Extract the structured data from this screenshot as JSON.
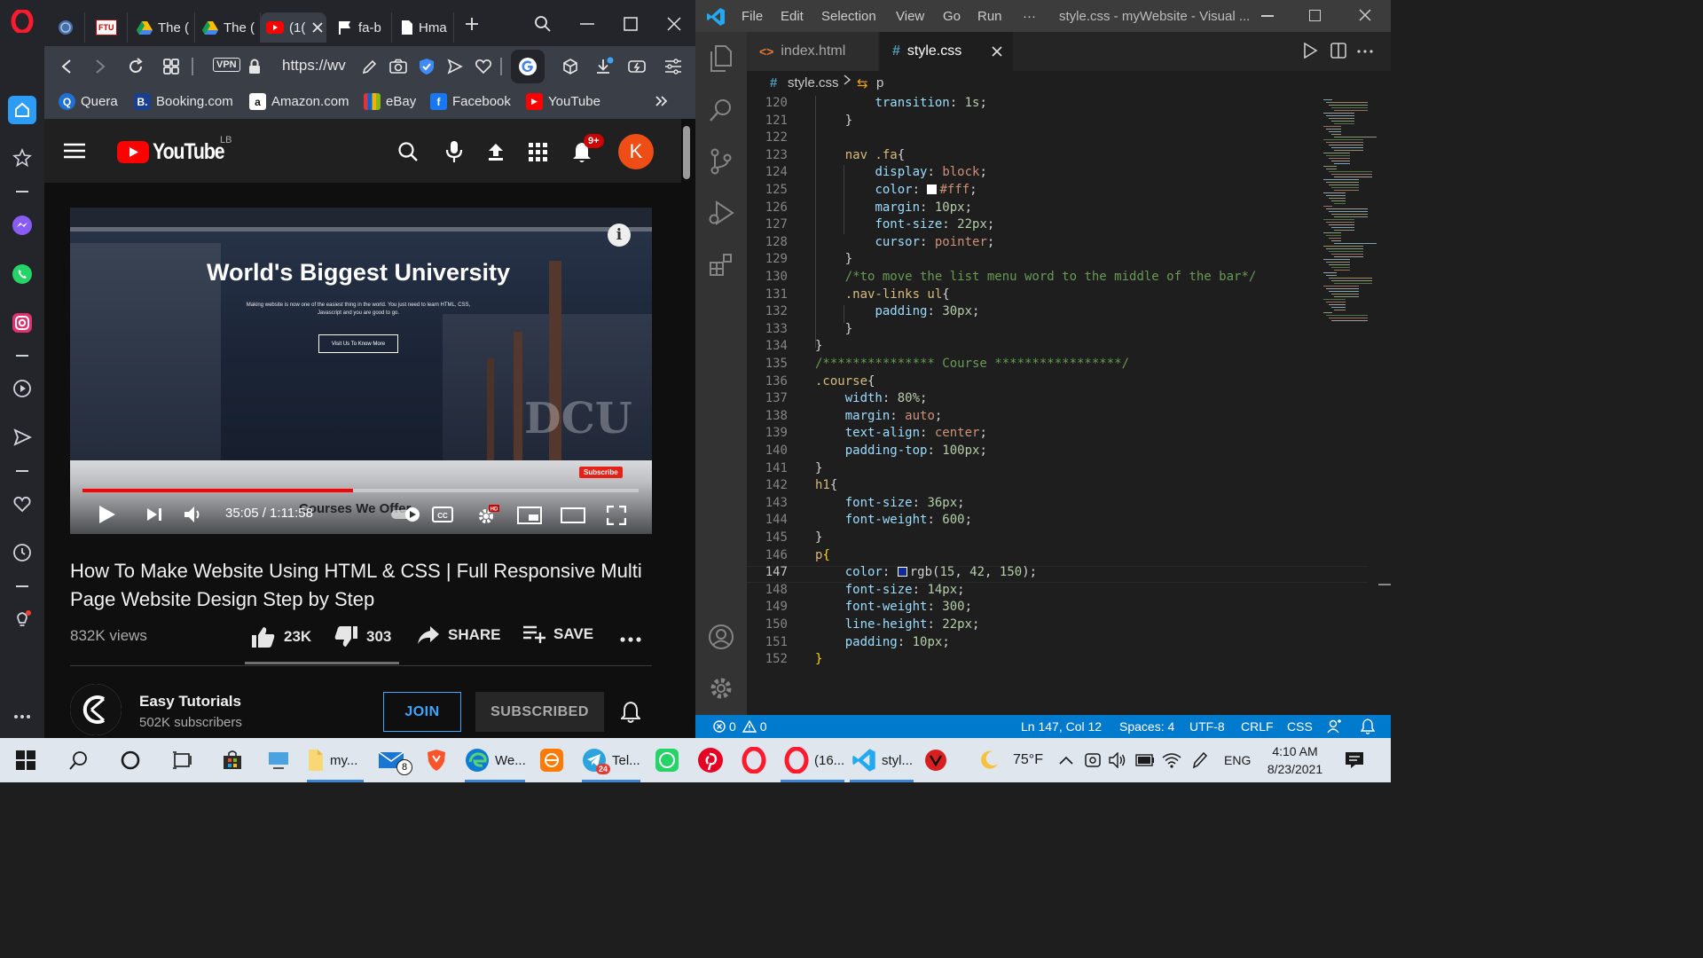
{
  "opera_sidebar": {
    "items": [
      "home",
      "speed-dial",
      "messenger",
      "whatsapp",
      "instagram",
      "player",
      "send",
      "favorites",
      "history",
      "tips",
      "more"
    ]
  },
  "browser": {
    "tabs": [
      {
        "label": "",
        "icon": "globe-icon"
      },
      {
        "label": "FTU",
        "icon": "ftu-icon"
      },
      {
        "label": "The (",
        "icon": "drive-icon"
      },
      {
        "label": "The (",
        "icon": "drive-icon"
      },
      {
        "label": "(1(",
        "icon": "youtube-icon",
        "active": true
      },
      {
        "label": "fa-b",
        "icon": "flag-icon"
      },
      {
        "label": "Hma",
        "icon": "page-icon"
      }
    ],
    "url": "https://wv",
    "vpn_label": "VPN",
    "bookmarks": [
      {
        "label": "Quera",
        "color": "#1f6fd6",
        "glyph": "Q"
      },
      {
        "label": "Booking.com",
        "color": "#1b3f8f",
        "glyph": "B."
      },
      {
        "label": "Amazon.com",
        "color": "#222222",
        "glyph": "a"
      },
      {
        "label": "eBay",
        "color": "#e53238",
        "glyph": "e"
      },
      {
        "label": "Facebook",
        "color": "#1877f2",
        "glyph": "f"
      },
      {
        "label": "YouTube",
        "color": "#ff0000",
        "glyph": "▶"
      }
    ]
  },
  "youtube": {
    "logo_text": "YouTube",
    "country_code": "LB",
    "notification_count": "9+",
    "avatar_letter": "K",
    "video": {
      "headline": "World's Biggest University",
      "subline": "Making website is now one of the easiest thing in the world. You just need to learn HTML, CSS, Javascript and you are good to go.",
      "cta": "Visit Us To Know More",
      "watermark": "DCU",
      "overlay_heading": "Courses We Offer",
      "subscribe_chip": "Subscribe",
      "time": "35:05 / 1:11:58",
      "progress": 0.487
    },
    "title": "How To Make Website Using HTML & CSS | Full Responsive Multi Page Website Design Step by Step",
    "views": "832K views",
    "likes": "23K",
    "dislikes": "303",
    "share_label": "SHARE",
    "save_label": "SAVE",
    "channel": {
      "name": "Easy Tutorials",
      "subscribers": "502K subscribers",
      "join_label": "JOIN",
      "subscribed_label": "SUBSCRIBED"
    }
  },
  "vscode": {
    "menu": [
      "File",
      "Edit",
      "Selection",
      "View",
      "Go",
      "Run",
      "···"
    ],
    "title": "style.css - myWebsite - Visual ...",
    "tabs": [
      {
        "label": "index.html",
        "icon": "html-icon"
      },
      {
        "label": "style.css",
        "icon": "css-icon",
        "active": true
      }
    ],
    "breadcrumb": [
      "style.css",
      "p"
    ],
    "lines": [
      {
        "n": "120",
        "parts": [
          [
            "        ",
            "k-plain"
          ],
          [
            "transition",
            "k-prop"
          ],
          [
            ": ",
            "k-plain"
          ],
          [
            "1s",
            "k-num"
          ],
          [
            ";",
            "k-plain"
          ]
        ]
      },
      {
        "n": "121",
        "parts": [
          [
            "    }",
            "k-plain"
          ]
        ]
      },
      {
        "n": "122",
        "parts": []
      },
      {
        "n": "123",
        "parts": [
          [
            "    ",
            "k-plain"
          ],
          [
            "nav .fa",
            "k-sel"
          ],
          [
            "{",
            "k-plain"
          ]
        ]
      },
      {
        "n": "124",
        "parts": [
          [
            "        ",
            "k-plain"
          ],
          [
            "display",
            "k-prop"
          ],
          [
            ": ",
            "k-plain"
          ],
          [
            "block",
            "k-val"
          ],
          [
            ";",
            "k-plain"
          ]
        ]
      },
      {
        "n": "125",
        "parts": [
          [
            "        ",
            "k-plain"
          ],
          [
            "color",
            "k-prop"
          ],
          [
            ": ",
            "k-plain"
          ],
          [
            "#fff",
            "k-val",
            "#ffffff"
          ],
          [
            ";",
            "k-plain"
          ]
        ]
      },
      {
        "n": "126",
        "parts": [
          [
            "        ",
            "k-plain"
          ],
          [
            "margin",
            "k-prop"
          ],
          [
            ": ",
            "k-plain"
          ],
          [
            "10px",
            "k-num"
          ],
          [
            ";",
            "k-plain"
          ]
        ]
      },
      {
        "n": "127",
        "parts": [
          [
            "        ",
            "k-plain"
          ],
          [
            "font-size",
            "k-prop"
          ],
          [
            ": ",
            "k-plain"
          ],
          [
            "22px",
            "k-num"
          ],
          [
            ";",
            "k-plain"
          ]
        ]
      },
      {
        "n": "128",
        "parts": [
          [
            "        ",
            "k-plain"
          ],
          [
            "cursor",
            "k-prop"
          ],
          [
            ": ",
            "k-plain"
          ],
          [
            "pointer",
            "k-val"
          ],
          [
            ";",
            "k-plain"
          ]
        ]
      },
      {
        "n": "129",
        "parts": [
          [
            "    }",
            "k-plain"
          ]
        ]
      },
      {
        "n": "130",
        "parts": [
          [
            "    ",
            "k-plain"
          ],
          [
            "/*to move the list menu word to the middle of the bar*/",
            "k-com"
          ]
        ]
      },
      {
        "n": "131",
        "parts": [
          [
            "    ",
            "k-plain"
          ],
          [
            ".nav-links ul",
            "k-sel"
          ],
          [
            "{",
            "k-plain"
          ]
        ]
      },
      {
        "n": "132",
        "parts": [
          [
            "        ",
            "k-plain"
          ],
          [
            "padding",
            "k-prop"
          ],
          [
            ": ",
            "k-plain"
          ],
          [
            "30px",
            "k-num"
          ],
          [
            ";",
            "k-plain"
          ]
        ]
      },
      {
        "n": "133",
        "parts": [
          [
            "    }",
            "k-plain"
          ]
        ]
      },
      {
        "n": "134",
        "parts": [
          [
            "}",
            "k-plain"
          ]
        ]
      },
      {
        "n": "135",
        "parts": [
          [
            "/*************** Course *****************/",
            "k-com"
          ]
        ]
      },
      {
        "n": "136",
        "parts": [
          [
            ".course",
            "k-sel"
          ],
          [
            "{",
            "k-plain"
          ]
        ]
      },
      {
        "n": "137",
        "parts": [
          [
            "    ",
            "k-plain"
          ],
          [
            "width",
            "k-prop"
          ],
          [
            ": ",
            "k-plain"
          ],
          [
            "80%",
            "k-num"
          ],
          [
            ";",
            "k-plain"
          ]
        ]
      },
      {
        "n": "138",
        "parts": [
          [
            "    ",
            "k-plain"
          ],
          [
            "margin",
            "k-prop"
          ],
          [
            ": ",
            "k-plain"
          ],
          [
            "auto",
            "k-val"
          ],
          [
            ";",
            "k-plain"
          ]
        ]
      },
      {
        "n": "139",
        "parts": [
          [
            "    ",
            "k-plain"
          ],
          [
            "text-align",
            "k-prop"
          ],
          [
            ": ",
            "k-plain"
          ],
          [
            "center",
            "k-val"
          ],
          [
            ";",
            "k-plain"
          ]
        ]
      },
      {
        "n": "140",
        "parts": [
          [
            "    ",
            "k-plain"
          ],
          [
            "padding-top",
            "k-prop"
          ],
          [
            ": ",
            "k-plain"
          ],
          [
            "100px",
            "k-num"
          ],
          [
            ";",
            "k-plain"
          ]
        ]
      },
      {
        "n": "141",
        "parts": [
          [
            "}",
            "k-plain"
          ]
        ]
      },
      {
        "n": "142",
        "parts": [
          [
            "h1",
            "k-sel"
          ],
          [
            "{",
            "k-plain"
          ]
        ]
      },
      {
        "n": "143",
        "parts": [
          [
            "    ",
            "k-plain"
          ],
          [
            "font-size",
            "k-prop"
          ],
          [
            ": ",
            "k-plain"
          ],
          [
            "36px",
            "k-num"
          ],
          [
            ";",
            "k-plain"
          ]
        ]
      },
      {
        "n": "144",
        "parts": [
          [
            "    ",
            "k-plain"
          ],
          [
            "font-weight",
            "k-prop"
          ],
          [
            ": ",
            "k-plain"
          ],
          [
            "600",
            "k-num"
          ],
          [
            ";",
            "k-plain"
          ]
        ]
      },
      {
        "n": "145",
        "parts": [
          [
            "}",
            "k-plain"
          ]
        ]
      },
      {
        "n": "146",
        "parts": [
          [
            "p",
            "k-sel"
          ],
          [
            "{",
            "k-brace"
          ]
        ]
      },
      {
        "n": "147",
        "parts": [
          [
            "    ",
            "k-plain"
          ],
          [
            "color",
            "k-prop"
          ],
          [
            ": ",
            "k-plain"
          ],
          [
            "rgb(",
            "k-plain",
            "#0f2a96"
          ],
          [
            "15",
            "k-num"
          ],
          [
            ", ",
            "k-plain"
          ],
          [
            "42",
            "k-num"
          ],
          [
            ", ",
            "k-plain"
          ],
          [
            "150",
            "k-num"
          ],
          [
            ");",
            "k-plain"
          ]
        ],
        "current": true
      },
      {
        "n": "148",
        "parts": [
          [
            "    ",
            "k-plain"
          ],
          [
            "font-size",
            "k-prop"
          ],
          [
            ": ",
            "k-plain"
          ],
          [
            "14px",
            "k-num"
          ],
          [
            ";",
            "k-plain"
          ]
        ]
      },
      {
        "n": "149",
        "parts": [
          [
            "    ",
            "k-plain"
          ],
          [
            "font-weight",
            "k-prop"
          ],
          [
            ": ",
            "k-plain"
          ],
          [
            "300",
            "k-num"
          ],
          [
            ";",
            "k-plain"
          ]
        ]
      },
      {
        "n": "150",
        "parts": [
          [
            "    ",
            "k-plain"
          ],
          [
            "line-height",
            "k-prop"
          ],
          [
            ": ",
            "k-plain"
          ],
          [
            "22px",
            "k-num"
          ],
          [
            ";",
            "k-plain"
          ]
        ]
      },
      {
        "n": "151",
        "parts": [
          [
            "    ",
            "k-plain"
          ],
          [
            "padding",
            "k-prop"
          ],
          [
            ": ",
            "k-plain"
          ],
          [
            "10px",
            "k-num"
          ],
          [
            ";",
            "k-plain"
          ]
        ]
      },
      {
        "n": "152",
        "parts": [
          [
            "}",
            "k-brace"
          ]
        ]
      }
    ],
    "status": {
      "errors": "0",
      "warnings": "0",
      "position": "Ln 147, Col 12",
      "spaces": "Spaces: 4",
      "encoding": "UTF-8",
      "eol": "CRLF",
      "language": "CSS"
    }
  },
  "taskbar": {
    "apps": [
      {
        "name": "file-explorer",
        "label": "my..."
      },
      {
        "name": "edge",
        "label": "We..."
      },
      {
        "name": "telegram",
        "label": "Tel...",
        "badge": "24"
      },
      {
        "name": "opera",
        "label": "(16..."
      },
      {
        "name": "vscode",
        "label": "styl..."
      }
    ],
    "mail_badge": "8",
    "weather": "75°F",
    "language": "ENG",
    "time": "4:10 AM",
    "date": "8/23/2021"
  }
}
